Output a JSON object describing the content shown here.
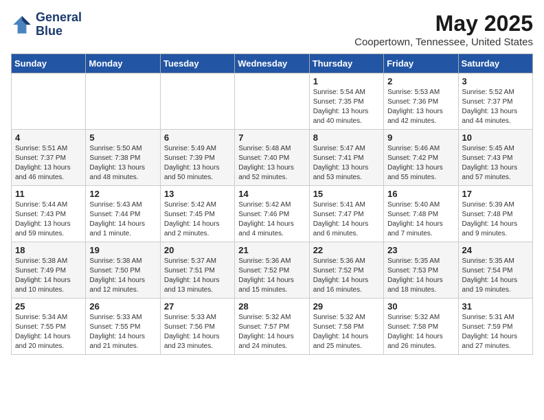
{
  "header": {
    "logo_line1": "General",
    "logo_line2": "Blue",
    "month": "May 2025",
    "location": "Coopertown, Tennessee, United States"
  },
  "days_of_week": [
    "Sunday",
    "Monday",
    "Tuesday",
    "Wednesday",
    "Thursday",
    "Friday",
    "Saturday"
  ],
  "weeks": [
    [
      {
        "num": "",
        "sunrise": "",
        "sunset": "",
        "daylight": ""
      },
      {
        "num": "",
        "sunrise": "",
        "sunset": "",
        "daylight": ""
      },
      {
        "num": "",
        "sunrise": "",
        "sunset": "",
        "daylight": ""
      },
      {
        "num": "",
        "sunrise": "",
        "sunset": "",
        "daylight": ""
      },
      {
        "num": "1",
        "sunrise": "Sunrise: 5:54 AM",
        "sunset": "Sunset: 7:35 PM",
        "daylight": "Daylight: 13 hours and 40 minutes."
      },
      {
        "num": "2",
        "sunrise": "Sunrise: 5:53 AM",
        "sunset": "Sunset: 7:36 PM",
        "daylight": "Daylight: 13 hours and 42 minutes."
      },
      {
        "num": "3",
        "sunrise": "Sunrise: 5:52 AM",
        "sunset": "Sunset: 7:37 PM",
        "daylight": "Daylight: 13 hours and 44 minutes."
      }
    ],
    [
      {
        "num": "4",
        "sunrise": "Sunrise: 5:51 AM",
        "sunset": "Sunset: 7:37 PM",
        "daylight": "Daylight: 13 hours and 46 minutes."
      },
      {
        "num": "5",
        "sunrise": "Sunrise: 5:50 AM",
        "sunset": "Sunset: 7:38 PM",
        "daylight": "Daylight: 13 hours and 48 minutes."
      },
      {
        "num": "6",
        "sunrise": "Sunrise: 5:49 AM",
        "sunset": "Sunset: 7:39 PM",
        "daylight": "Daylight: 13 hours and 50 minutes."
      },
      {
        "num": "7",
        "sunrise": "Sunrise: 5:48 AM",
        "sunset": "Sunset: 7:40 PM",
        "daylight": "Daylight: 13 hours and 52 minutes."
      },
      {
        "num": "8",
        "sunrise": "Sunrise: 5:47 AM",
        "sunset": "Sunset: 7:41 PM",
        "daylight": "Daylight: 13 hours and 53 minutes."
      },
      {
        "num": "9",
        "sunrise": "Sunrise: 5:46 AM",
        "sunset": "Sunset: 7:42 PM",
        "daylight": "Daylight: 13 hours and 55 minutes."
      },
      {
        "num": "10",
        "sunrise": "Sunrise: 5:45 AM",
        "sunset": "Sunset: 7:43 PM",
        "daylight": "Daylight: 13 hours and 57 minutes."
      }
    ],
    [
      {
        "num": "11",
        "sunrise": "Sunrise: 5:44 AM",
        "sunset": "Sunset: 7:43 PM",
        "daylight": "Daylight: 13 hours and 59 minutes."
      },
      {
        "num": "12",
        "sunrise": "Sunrise: 5:43 AM",
        "sunset": "Sunset: 7:44 PM",
        "daylight": "Daylight: 14 hours and 1 minute."
      },
      {
        "num": "13",
        "sunrise": "Sunrise: 5:42 AM",
        "sunset": "Sunset: 7:45 PM",
        "daylight": "Daylight: 14 hours and 2 minutes."
      },
      {
        "num": "14",
        "sunrise": "Sunrise: 5:42 AM",
        "sunset": "Sunset: 7:46 PM",
        "daylight": "Daylight: 14 hours and 4 minutes."
      },
      {
        "num": "15",
        "sunrise": "Sunrise: 5:41 AM",
        "sunset": "Sunset: 7:47 PM",
        "daylight": "Daylight: 14 hours and 6 minutes."
      },
      {
        "num": "16",
        "sunrise": "Sunrise: 5:40 AM",
        "sunset": "Sunset: 7:48 PM",
        "daylight": "Daylight: 14 hours and 7 minutes."
      },
      {
        "num": "17",
        "sunrise": "Sunrise: 5:39 AM",
        "sunset": "Sunset: 7:48 PM",
        "daylight": "Daylight: 14 hours and 9 minutes."
      }
    ],
    [
      {
        "num": "18",
        "sunrise": "Sunrise: 5:38 AM",
        "sunset": "Sunset: 7:49 PM",
        "daylight": "Daylight: 14 hours and 10 minutes."
      },
      {
        "num": "19",
        "sunrise": "Sunrise: 5:38 AM",
        "sunset": "Sunset: 7:50 PM",
        "daylight": "Daylight: 14 hours and 12 minutes."
      },
      {
        "num": "20",
        "sunrise": "Sunrise: 5:37 AM",
        "sunset": "Sunset: 7:51 PM",
        "daylight": "Daylight: 14 hours and 13 minutes."
      },
      {
        "num": "21",
        "sunrise": "Sunrise: 5:36 AM",
        "sunset": "Sunset: 7:52 PM",
        "daylight": "Daylight: 14 hours and 15 minutes."
      },
      {
        "num": "22",
        "sunrise": "Sunrise: 5:36 AM",
        "sunset": "Sunset: 7:52 PM",
        "daylight": "Daylight: 14 hours and 16 minutes."
      },
      {
        "num": "23",
        "sunrise": "Sunrise: 5:35 AM",
        "sunset": "Sunset: 7:53 PM",
        "daylight": "Daylight: 14 hours and 18 minutes."
      },
      {
        "num": "24",
        "sunrise": "Sunrise: 5:35 AM",
        "sunset": "Sunset: 7:54 PM",
        "daylight": "Daylight: 14 hours and 19 minutes."
      }
    ],
    [
      {
        "num": "25",
        "sunrise": "Sunrise: 5:34 AM",
        "sunset": "Sunset: 7:55 PM",
        "daylight": "Daylight: 14 hours and 20 minutes."
      },
      {
        "num": "26",
        "sunrise": "Sunrise: 5:33 AM",
        "sunset": "Sunset: 7:55 PM",
        "daylight": "Daylight: 14 hours and 21 minutes."
      },
      {
        "num": "27",
        "sunrise": "Sunrise: 5:33 AM",
        "sunset": "Sunset: 7:56 PM",
        "daylight": "Daylight: 14 hours and 23 minutes."
      },
      {
        "num": "28",
        "sunrise": "Sunrise: 5:32 AM",
        "sunset": "Sunset: 7:57 PM",
        "daylight": "Daylight: 14 hours and 24 minutes."
      },
      {
        "num": "29",
        "sunrise": "Sunrise: 5:32 AM",
        "sunset": "Sunset: 7:58 PM",
        "daylight": "Daylight: 14 hours and 25 minutes."
      },
      {
        "num": "30",
        "sunrise": "Sunrise: 5:32 AM",
        "sunset": "Sunset: 7:58 PM",
        "daylight": "Daylight: 14 hours and 26 minutes."
      },
      {
        "num": "31",
        "sunrise": "Sunrise: 5:31 AM",
        "sunset": "Sunset: 7:59 PM",
        "daylight": "Daylight: 14 hours and 27 minutes."
      }
    ]
  ]
}
